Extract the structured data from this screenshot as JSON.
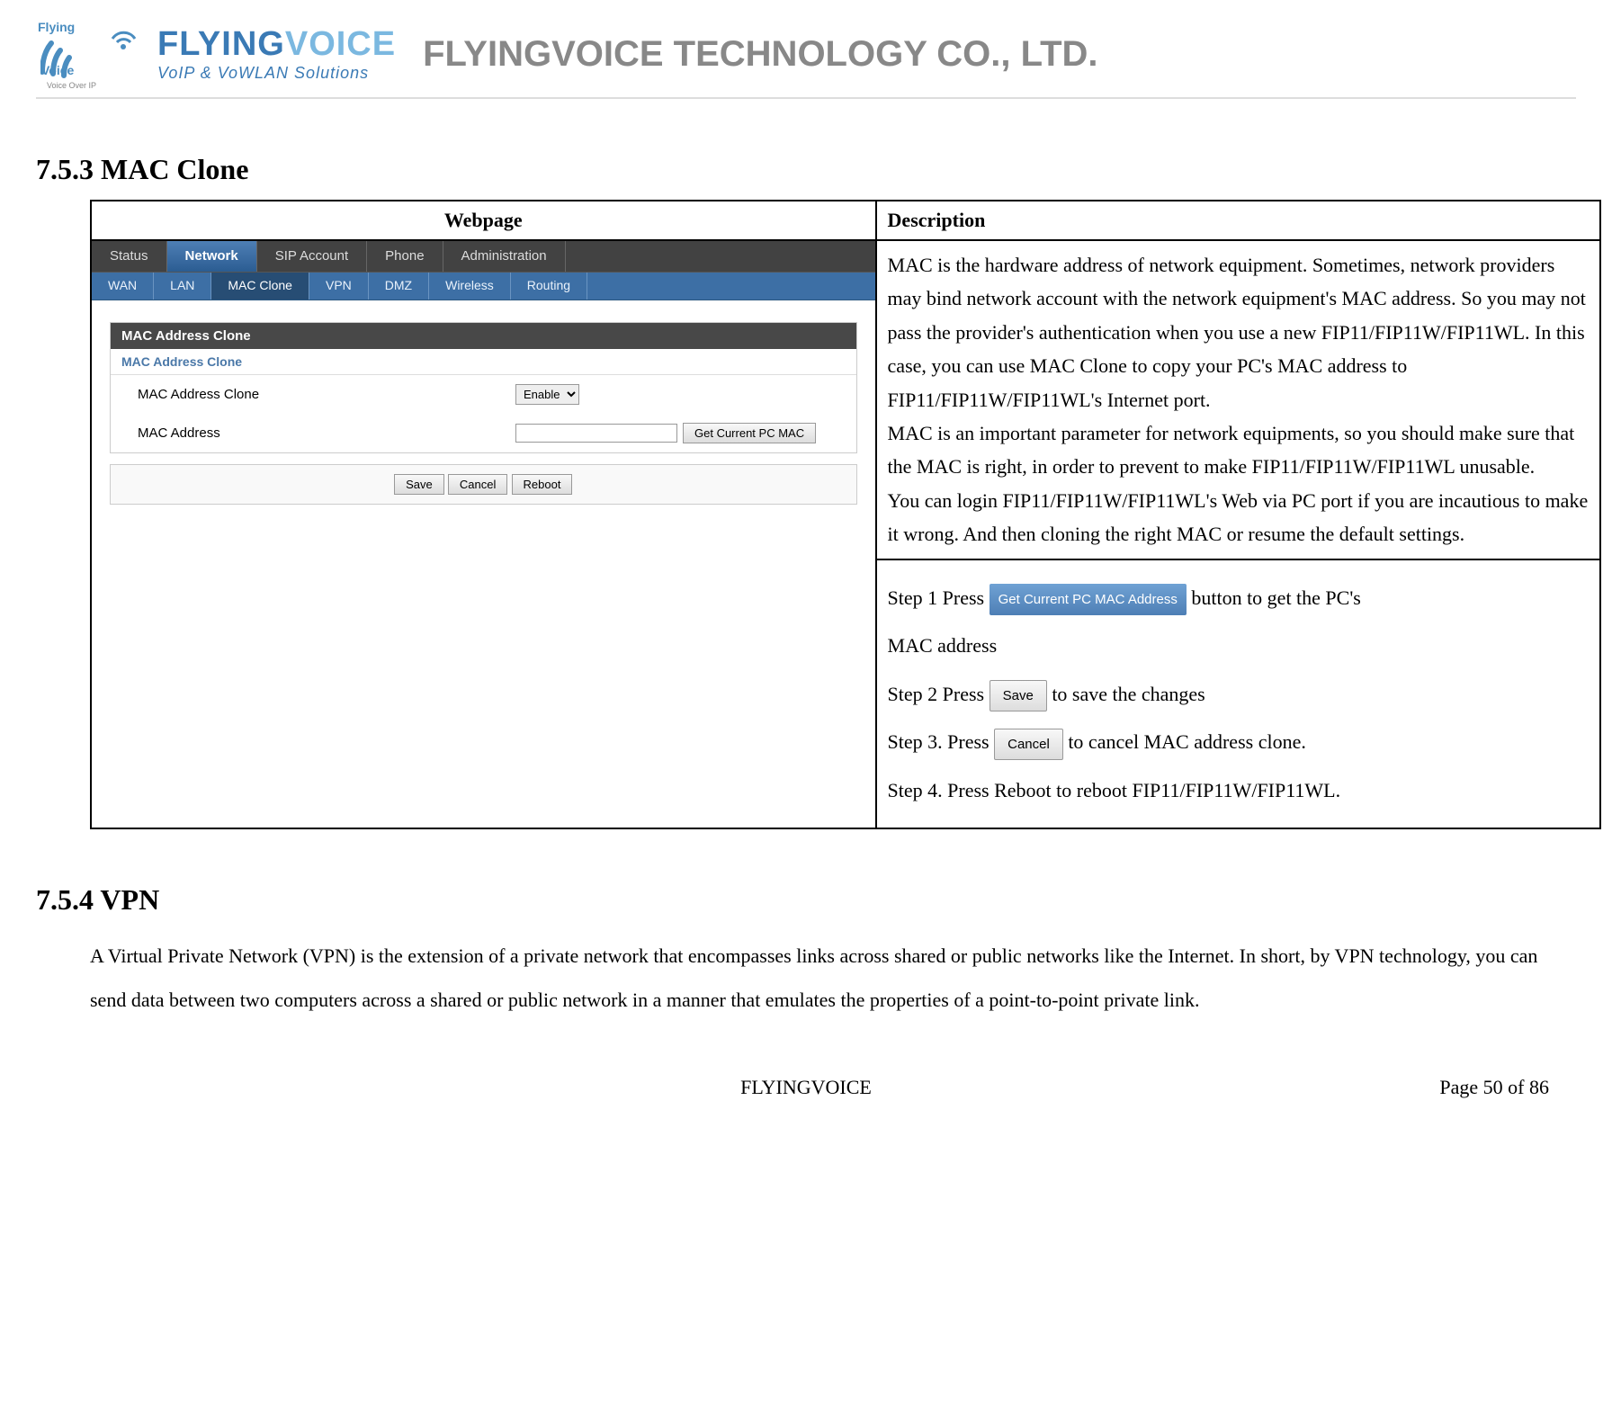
{
  "header": {
    "logo_text_top": "Flying",
    "logo_text_bottom": "Voice",
    "logo_tagline": "Voice Over IP",
    "brand": "FLYINGVOICE",
    "brand_tag": "VoIP & VoWLAN Solutions",
    "company": "FLYINGVOICE TECHNOLOGY CO., LTD."
  },
  "section1": {
    "number_title": "7.5.3    MAC Clone",
    "col_webpage": "Webpage",
    "col_description": "Description",
    "tabs_top": [
      "Status",
      "Network",
      "SIP Account",
      "Phone",
      "Administration"
    ],
    "tabs_sub": [
      "WAN",
      "LAN",
      "MAC Clone",
      "VPN",
      "DMZ",
      "Wireless",
      "Routing"
    ],
    "panel_title": "MAC Address Clone",
    "section_label": "MAC Address Clone",
    "row1_label": "MAC Address Clone",
    "row1_select": "Enable",
    "row2_label": "MAC Address",
    "row2_input": "",
    "row2_btn": "Get Current PC MAC",
    "btn_save": "Save",
    "btn_cancel": "Cancel",
    "btn_reboot": "Reboot",
    "description": "MAC is the hardware address of network equipment. Sometimes, network providers may bind network account with the network equipment's MAC address. So you may not pass the provider's authentication when you use a new FIP11/FIP11W/FIP11WL. In this case, you can use MAC Clone to copy your PC's MAC address to FIP11/FIP11W/FIP11WL's Internet port.\nMAC is an important parameter for network equipments, so you should make sure that the MAC is right, in order to prevent to make FIP11/FIP11W/FIP11WL unusable.\nYou can login FIP11/FIP11W/FIP11WL's Web via PC port if you are incautious to make it wrong. And then cloning the right MAC or resume the default settings.",
    "steps": {
      "s1a": "Step 1 Press ",
      "s1_btn": "Get Current PC MAC Address",
      "s1b": " button to get the PC's",
      "s1c": "MAC address",
      "s2a": "Step 2 Press   ",
      "s2_btn": "Save",
      "s2b": "   to save the changes",
      "s3a": "Step 3. Press   ",
      "s3_btn": "Cancel",
      "s3b": "   to cancel MAC address clone.",
      "s4": "Step 4. Press Reboot to reboot FIP11/FIP11W/FIP11WL."
    }
  },
  "section2": {
    "number_title": "7.5.4    VPN",
    "text": "A Virtual Private Network (VPN) is the extension of a private network that encompasses links across shared or public networks like the Internet. In short, by VPN technology, you can send data between two computers across a shared or public network in a manner that emulates the properties of a point-to-point private link."
  },
  "footer": {
    "center": "FLYINGVOICE",
    "right": "Page  50  of  86"
  }
}
